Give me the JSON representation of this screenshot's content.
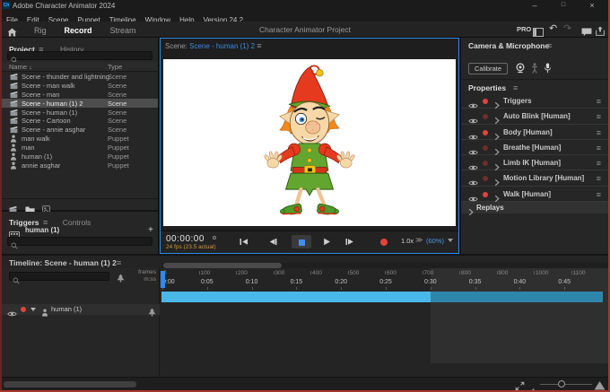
{
  "window": {
    "title": "Adobe Character Animator 2024",
    "app_icon_text": "Ch",
    "minimize_glyph": "–",
    "maximize_glyph": "□",
    "close_glyph": "×"
  },
  "menu": {
    "items": [
      "File",
      "Edit",
      "Scene",
      "Puppet",
      "Timeline",
      "Window",
      "Help",
      "Version 24.2"
    ]
  },
  "toolbar": {
    "tabs": [
      {
        "label": "Rig",
        "active": false
      },
      {
        "label": "Record",
        "active": true
      },
      {
        "label": "Stream",
        "active": false
      }
    ],
    "project_title": "Character Animator Project",
    "pro_label": "PRO",
    "undo_glyph": "↶",
    "redo_glyph": "↷"
  },
  "project": {
    "tab_label": "Project",
    "history_label": "History",
    "col_name": "Name",
    "sort_glyph": "↓",
    "col_type": "Type",
    "items": [
      {
        "name": "Scene - thunder and lightning",
        "type": "Scene",
        "icon": "scene",
        "selected": false
      },
      {
        "name": "Scene - man walk",
        "type": "Scene",
        "icon": "scene",
        "selected": false
      },
      {
        "name": "Scene - man",
        "type": "Scene",
        "icon": "scene",
        "selected": false
      },
      {
        "name": "Scene - human (1) 2",
        "type": "Scene",
        "icon": "scene",
        "selected": true
      },
      {
        "name": "Scene - human (1)",
        "type": "Scene",
        "icon": "scene",
        "selected": false
      },
      {
        "name": "Scene - Cartoon",
        "type": "Scene",
        "icon": "scene",
        "selected": false
      },
      {
        "name": "Scene - annie asghar",
        "type": "Scene",
        "icon": "scene",
        "selected": false
      },
      {
        "name": "man walk",
        "type": "Puppet",
        "icon": "puppet",
        "selected": false
      },
      {
        "name": "man",
        "type": "Puppet",
        "icon": "puppet",
        "selected": false
      },
      {
        "name": "human (1)",
        "type": "Puppet",
        "icon": "puppet",
        "selected": false
      },
      {
        "name": "annie asghar",
        "type": "Puppet",
        "icon": "puppet",
        "selected": false
      }
    ]
  },
  "triggers": {
    "tab_label": "Triggers",
    "controls_label": "Controls",
    "item": "human (1)",
    "add_glyph": "+"
  },
  "scene": {
    "label": "Scene:",
    "name": "Scene - human (1) 2"
  },
  "playback": {
    "timecode": "00:00:00",
    "fps": "24 fps (23.5 actual)",
    "speed": "1.0x",
    "ff_glyph": "≫",
    "zoom": "(60%)"
  },
  "camera": {
    "title": "Camera & Microphone",
    "calibrate_label": "Calibrate"
  },
  "properties": {
    "title": "Properties",
    "rows": [
      {
        "label": "Triggers",
        "armed": true
      },
      {
        "label": "Auto Blink [Human]",
        "armed": false
      },
      {
        "label": "Body [Human]",
        "armed": true
      },
      {
        "label": "Breathe [Human]",
        "armed": false
      },
      {
        "label": "Limb IK [Human]",
        "armed": false
      },
      {
        "label": "Motion Library [Human]",
        "armed": false
      },
      {
        "label": "Walk [Human]",
        "armed": true
      }
    ],
    "replays_label": "Replays"
  },
  "timeline": {
    "title": "Timeline: Scene - human (1) 2",
    "frames_label": "frames",
    "mss_label": "m:ss",
    "track_label": "human (1)",
    "ruler": {
      "frames": [
        "0",
        "100",
        "200",
        "300",
        "400",
        "500",
        "600",
        "700",
        "800",
        "900",
        "1000",
        "1100"
      ],
      "times": [
        "0:00",
        "0:05",
        "0:10",
        "0:15",
        "0:20",
        "0:25",
        "0:30",
        "0:35",
        "0:40",
        "0:45"
      ]
    }
  },
  "icons": {
    "hamburger_glyph": "≡"
  },
  "colors": {
    "accent_blue": "#3f8ae0",
    "record_red": "#e0443e",
    "track_cyan": "#49b8e8",
    "fps_orange": "#cf953d",
    "selection_gray": "#4d4d4d"
  }
}
